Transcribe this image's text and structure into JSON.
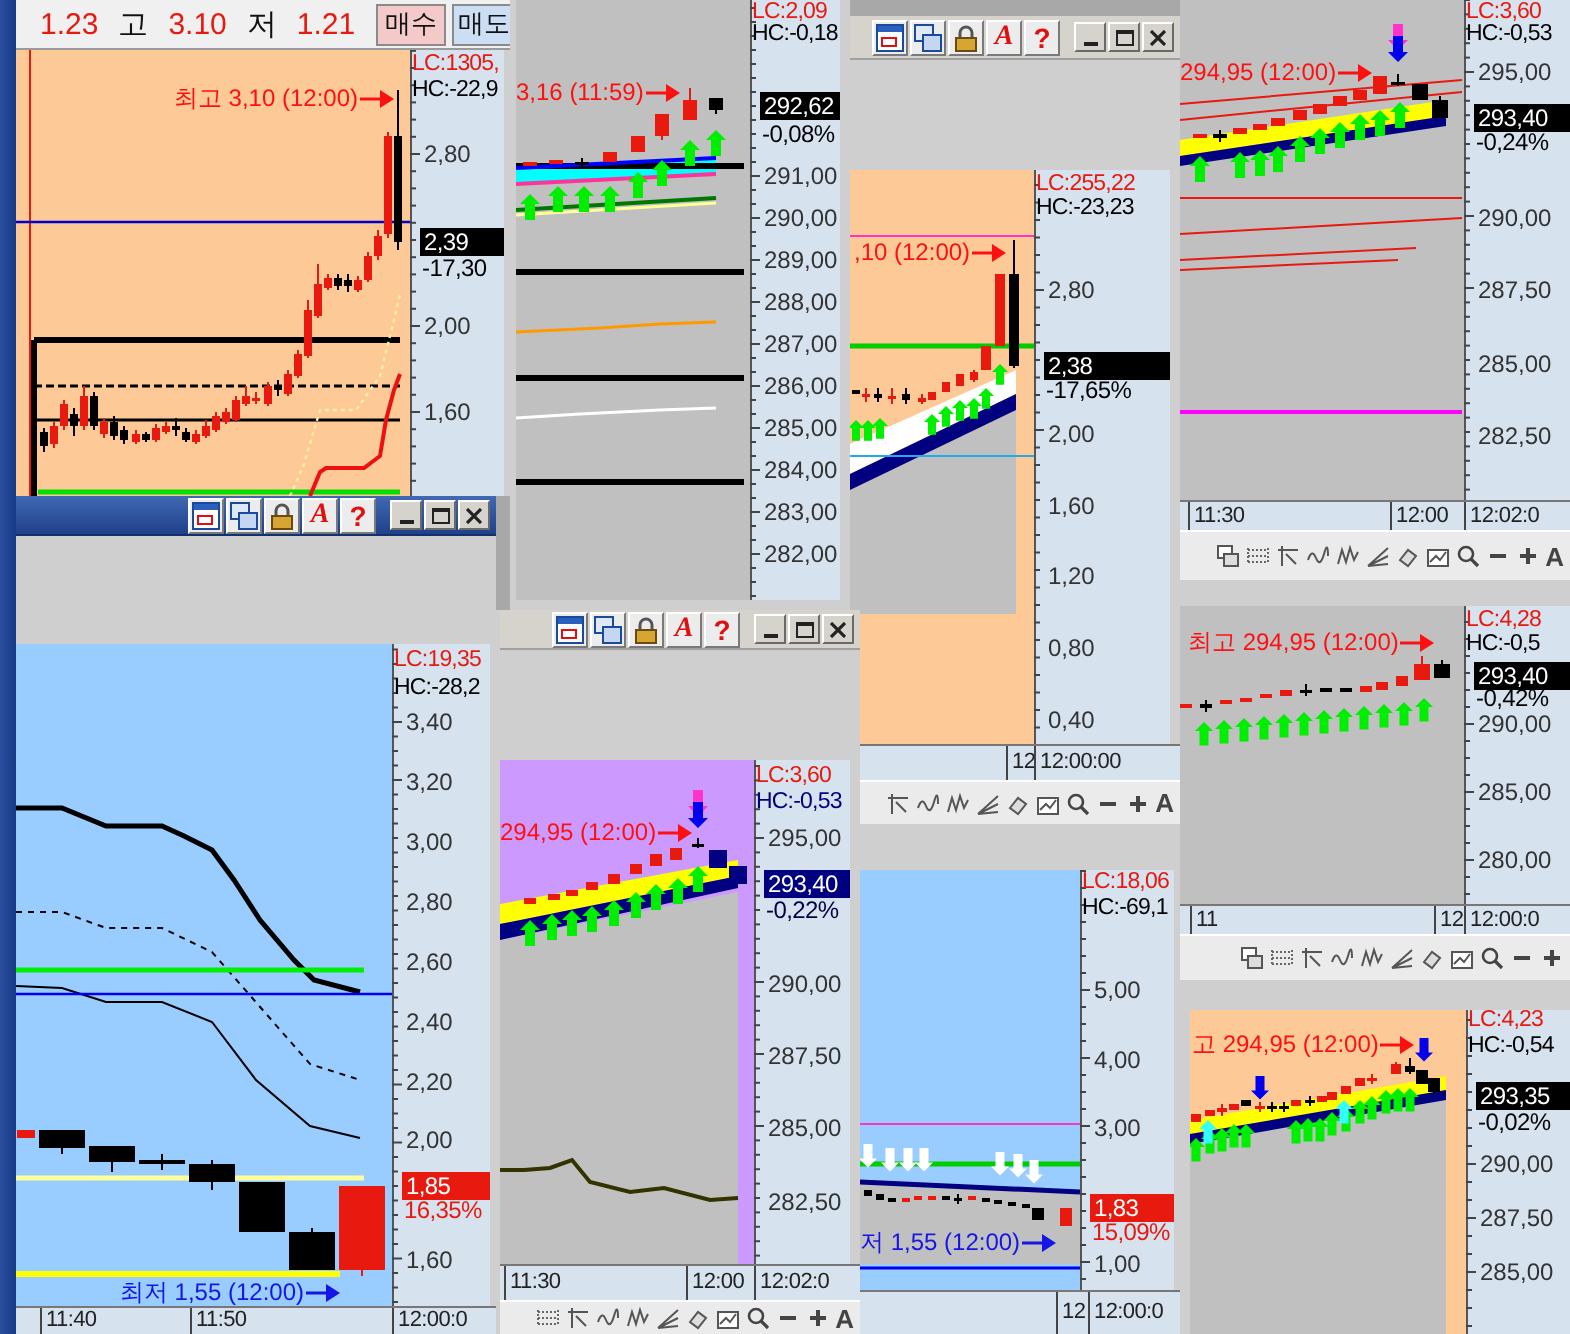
{
  "quote_bar": {
    "fields": [
      {
        "value": "1.23"
      },
      {
        "label": "고",
        "value": "3.10"
      },
      {
        "label": "저",
        "value": "1.21"
      }
    ],
    "buttons": [
      {
        "kind": "buy",
        "label": "매수"
      },
      {
        "kind": "sell",
        "label": "매도"
      }
    ]
  },
  "chart_windows": [
    {
      "axis": {
        "lc": "LC:1305,",
        "hc": "HC:-22,9",
        "ticks": [
          "2,80",
          "2,00",
          "1,60"
        ],
        "price": "2,39",
        "change": "-17,30"
      },
      "annotation": {
        "kind": "high",
        "text": "최고 3,10 (12:00)"
      }
    },
    {
      "title_bar": {
        "active": true,
        "glyphs": [
          "A",
          "?"
        ]
      },
      "axis": {
        "lc": "LC:19,35",
        "hc": "HC:-28,2",
        "ticks": [
          "3,40",
          "3,20",
          "3,00",
          "2,80",
          "2,60",
          "2,40",
          "2,20",
          "2,00",
          "1,60"
        ],
        "price": "1,85",
        "change": "16,35%"
      },
      "annotation": {
        "kind": "low",
        "text": "최저 1,55 (12:00)"
      },
      "time_labels": [
        "11:40",
        "11:50",
        "12:00:0"
      ]
    },
    {
      "axis": {
        "lc": "LC:2,09",
        "hc": "HC:-0,18",
        "ticks": [
          "291,00",
          "290,00",
          "289,00",
          "288,00",
          "287,00",
          "286,00",
          "285,00",
          "284,00",
          "283,00",
          "282,00"
        ],
        "price": "292,62",
        "change": "-0,08%"
      },
      "annotation": {
        "kind": "high",
        "text": "3,16 (11:59)"
      }
    },
    {
      "title_bar": {
        "active": false,
        "glyphs": [
          "A",
          "?"
        ]
      },
      "axis": {
        "lc": "LC:3,60",
        "hc": "HC:-0,53",
        "ticks": [
          "295,00",
          "290,00",
          "287,50",
          "285,00",
          "282,50"
        ],
        "price": "293,40",
        "change": "-0,22%"
      },
      "annotation": {
        "kind": "high",
        "text": "294,95 (12:00)"
      },
      "time_labels": [
        "11:30",
        "12:00",
        "12:02:0"
      ],
      "toolbar_glyph": "A"
    },
    {
      "title_bar": {
        "active": false,
        "glyphs": [
          "A",
          "?"
        ]
      },
      "axis": {
        "lc": "LC:255,22",
        "hc": "HC:-23,23",
        "ticks": [
          "2,80",
          "2,00",
          "1,60",
          "1,20",
          "0,80",
          "0,40"
        ],
        "price": "2,38",
        "change": "-17,65%"
      },
      "annotation": {
        "kind": "high",
        "text": ",10 (12:00)"
      },
      "time_labels": [
        "12",
        "12:00:00"
      ],
      "toolbar_glyph": "A"
    },
    {
      "axis": {
        "lc": "LC:3,60",
        "hc": "HC:-0,53",
        "ticks": [
          "295,00",
          "290,00",
          "287,50",
          "285,00",
          "282,50"
        ],
        "price": "293,40",
        "change": "-0,24%"
      },
      "annotation": {
        "kind": "high",
        "text": "294,95 (12:00)"
      },
      "time_labels": [
        "11:30",
        "12:00",
        "12:02:0"
      ],
      "toolbar_glyph": "A"
    },
    {
      "axis": {
        "lc": "LC:4,28",
        "hc": "HC:-0,5",
        "ticks": [
          "290,00",
          "285,00",
          "280,00"
        ],
        "price": "293,40",
        "change": "-0,42%"
      },
      "annotation": {
        "kind": "high",
        "text": "최고 294,95 (12:00)"
      },
      "time_labels": [
        "11",
        "12",
        "12:00:0"
      ]
    },
    {
      "axis": {
        "lc": "LC:18,06",
        "hc": "HC:-69,1",
        "ticks": [
          "5,00",
          "4,00",
          "3,00",
          "1,00"
        ],
        "price": "1,83",
        "change": "15,09%"
      },
      "annotation": {
        "kind": "low",
        "text": "저 1,55 (12:00)"
      },
      "time_labels": [
        "12",
        "12:00:0"
      ]
    },
    {
      "axis": {
        "lc": "LC:4,23",
        "hc": "HC:-0,54",
        "ticks": [
          "290,00",
          "287,50",
          "285,00"
        ],
        "price": "293,35",
        "change": "-0,02%"
      },
      "annotation": {
        "kind": "high",
        "text": "고 294,95 (12:00)"
      }
    }
  ]
}
